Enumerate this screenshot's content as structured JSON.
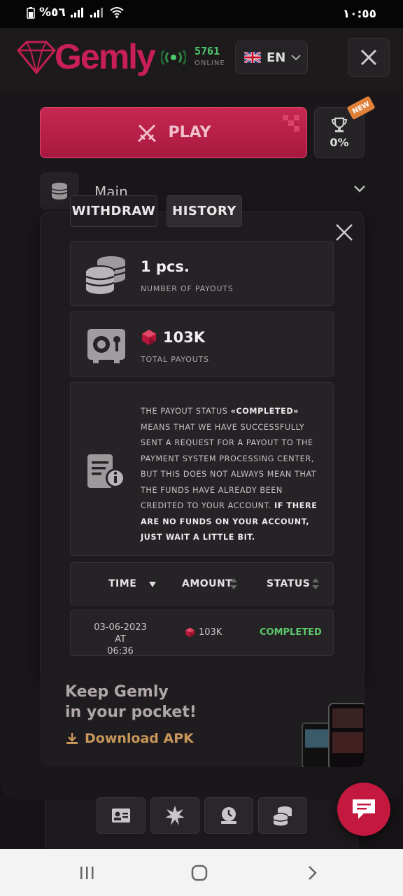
{
  "status_bar": {
    "battery_pct": "%٥٦",
    "time": "١٠:٥٥"
  },
  "header": {
    "logo_text": "Gemly",
    "online_count": "5761",
    "online_label": "ONLINE",
    "language": "EN"
  },
  "play": {
    "label": "PLAY",
    "new_badge": "NEW",
    "percent": "0%"
  },
  "main_menu": {
    "label": "Main"
  },
  "tabs": {
    "withdraw": "WITHDRAW",
    "history": "HISTORY"
  },
  "stats": {
    "payouts_value": "1 pcs.",
    "payouts_label": "NUMBER OF PAYOUTS",
    "total_value": "103K",
    "total_label": "TOTAL PAYOUTS"
  },
  "notice": {
    "part1": "THE PAYOUT STATUS ",
    "status_word": "«COMPLETED»",
    "part2": " MEANS THAT WE HAVE SUCCESSFULLY SENT A REQUEST FOR A PAYOUT TO THE PAYMENT SYSTEM PROCESSING CENTER, BUT THIS DOES NOT ALWAYS MEAN THAT THE FUNDS HAVE ALREADY BEEN CREDITED TO YOUR ACCOUNT. ",
    "bold_tail": "IF THERE ARE NO FUNDS ON YOUR ACCOUNT, JUST WAIT A LITTLE BIT."
  },
  "table": {
    "columns": [
      "TIME",
      "AMOUNT",
      "STATUS"
    ],
    "rows": [
      {
        "time_line1": "03-06-2023 AT",
        "time_line2": "06:36",
        "amount": "103K",
        "status": "COMPLETED"
      }
    ]
  },
  "promo": {
    "line1": "Keep Gemly",
    "line2": "in your pocket!",
    "link": "Download APK"
  },
  "colors": {
    "accent": "#c62851",
    "success": "#5cc86a",
    "gold": "#c7965a"
  }
}
